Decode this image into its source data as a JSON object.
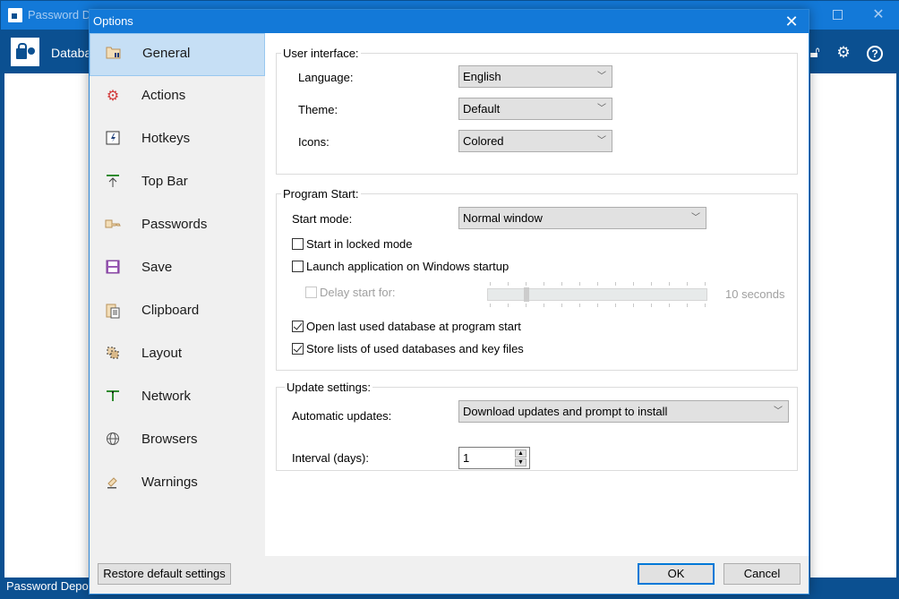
{
  "app": {
    "title": "Password Depot",
    "menu_database": "Database",
    "status_text": "Password Depot",
    "toolbar_icons": [
      "lock-icon",
      "gear-icon",
      "help-icon"
    ]
  },
  "dialog": {
    "title": "Options",
    "close_glyph": "✕",
    "nav": [
      {
        "label": "General",
        "icon": "folder-tools-icon",
        "active": true
      },
      {
        "label": "Actions",
        "icon": "gear-red-icon",
        "active": false
      },
      {
        "label": "Hotkeys",
        "icon": "hotkey-icon",
        "active": false
      },
      {
        "label": "Top Bar",
        "icon": "top-bar-icon",
        "active": false
      },
      {
        "label": "Passwords",
        "icon": "key-icon",
        "active": false
      },
      {
        "label": "Save",
        "icon": "floppy-icon",
        "active": false
      },
      {
        "label": "Clipboard",
        "icon": "clipboard-icon",
        "active": false
      },
      {
        "label": "Layout",
        "icon": "layout-icon",
        "active": false
      },
      {
        "label": "Network",
        "icon": "network-icon",
        "active": false
      },
      {
        "label": "Browsers",
        "icon": "globe-icon",
        "active": false
      },
      {
        "label": "Warnings",
        "icon": "gavel-icon",
        "active": false
      }
    ],
    "user_interface": {
      "title": "User interface:",
      "language_label": "Language:",
      "language_value": "English",
      "theme_label": "Theme:",
      "theme_value": "Default",
      "icons_label": "Icons:",
      "icons_value": "Colored"
    },
    "program_start": {
      "title": "Program Start:",
      "start_mode_label": "Start mode:",
      "start_mode_value": "Normal window",
      "start_locked_label": "Start in locked mode",
      "start_locked_checked": false,
      "launch_startup_label": "Launch application on Windows startup",
      "launch_startup_checked": false,
      "delay_label": "Delay start for:",
      "delay_checked": false,
      "delay_enabled": false,
      "delay_slider_fraction": 0.1667,
      "delay_value_text": "10 seconds",
      "open_last_label": "Open last used database at program start",
      "open_last_checked": true,
      "store_lists_label": "Store lists of used databases and key files",
      "store_lists_checked": true
    },
    "update_settings": {
      "title": "Update settings:",
      "auto_updates_label": "Automatic updates:",
      "auto_updates_value": "Download updates and prompt to install",
      "interval_label": "Interval (days):",
      "interval_value": "1"
    },
    "footer": {
      "restore_label": "Restore default settings",
      "ok_label": "OK",
      "cancel_label": "Cancel"
    }
  }
}
